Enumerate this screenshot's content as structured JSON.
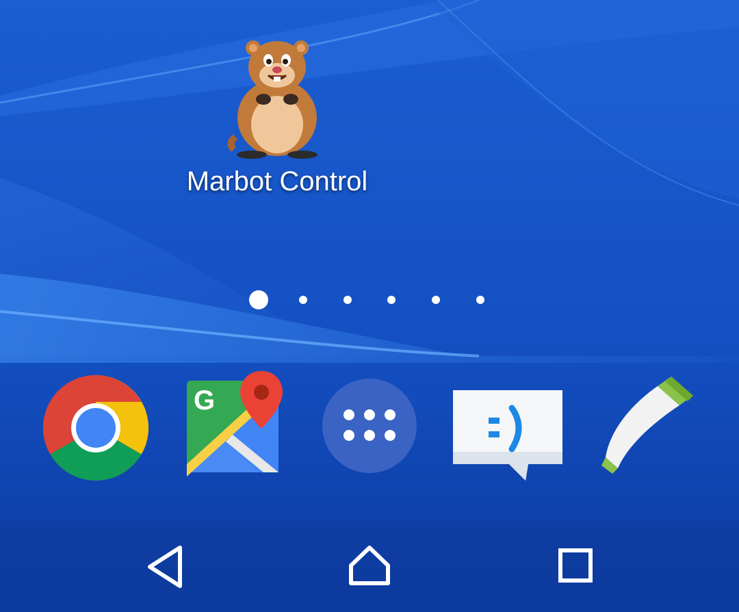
{
  "home": {
    "shortcut": {
      "label": "Marbot Control",
      "icon": "groundhog-icon"
    },
    "page_indicator": {
      "page_count": 6,
      "current_page": 1
    }
  },
  "dock": {
    "items": [
      {
        "icon": "chrome-icon"
      },
      {
        "icon": "google-maps-icon"
      },
      {
        "icon": "app-drawer-icon"
      },
      {
        "icon": "messaging-icon"
      },
      {
        "icon": "phone-icon"
      }
    ]
  },
  "navigation_bar": {
    "buttons": [
      {
        "icon": "back-icon"
      },
      {
        "icon": "home-icon"
      },
      {
        "icon": "recents-icon"
      }
    ]
  },
  "colors": {
    "wallpaper_primary": "#1452c4",
    "wallpaper_dark": "#0d3fa8",
    "wave_light": "#3c86e6",
    "nav_bar_background": "#0e3b9c"
  }
}
